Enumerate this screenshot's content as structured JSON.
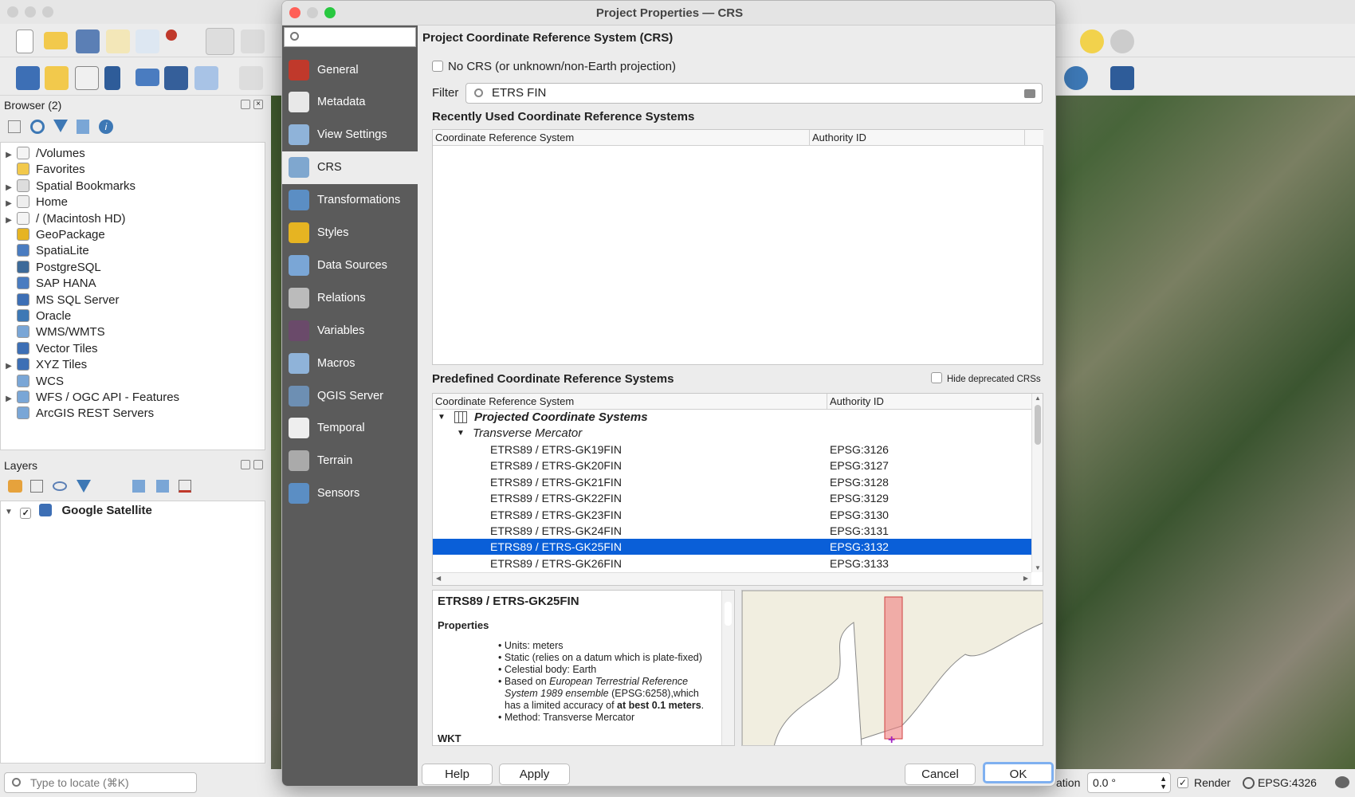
{
  "main_window": {
    "browser_panel": {
      "title": "Browser (2)",
      "items": [
        {
          "label": "/Volumes",
          "expandable": true,
          "icon": "folder-icon"
        },
        {
          "label": "Favorites",
          "expandable": false,
          "icon": "star-icon"
        },
        {
          "label": "Spatial Bookmarks",
          "expandable": true,
          "icon": "bookmark-icon"
        },
        {
          "label": "Home",
          "expandable": true,
          "icon": "home-icon"
        },
        {
          "label": "/ (Macintosh HD)",
          "expandable": true,
          "icon": "folder-icon"
        },
        {
          "label": "GeoPackage",
          "expandable": false,
          "icon": "geopackage-icon"
        },
        {
          "label": "SpatiaLite",
          "expandable": false,
          "icon": "spatialite-icon"
        },
        {
          "label": "PostgreSQL",
          "expandable": false,
          "icon": "postgresql-icon"
        },
        {
          "label": "SAP HANA",
          "expandable": false,
          "icon": "sap-hana-icon"
        },
        {
          "label": "MS SQL Server",
          "expandable": false,
          "icon": "mssql-icon"
        },
        {
          "label": "Oracle",
          "expandable": false,
          "icon": "oracle-icon"
        },
        {
          "label": "WMS/WMTS",
          "expandable": false,
          "icon": "globe-icon"
        },
        {
          "label": "Vector Tiles",
          "expandable": false,
          "icon": "grid-icon"
        },
        {
          "label": "XYZ Tiles",
          "expandable": true,
          "icon": "grid-icon"
        },
        {
          "label": "WCS",
          "expandable": false,
          "icon": "globe-icon"
        },
        {
          "label": "WFS / OGC API - Features",
          "expandable": true,
          "icon": "globe-icon"
        },
        {
          "label": "ArcGIS REST Servers",
          "expandable": false,
          "icon": "globe-icon"
        }
      ]
    },
    "layers_panel": {
      "title": "Layers",
      "layers": [
        {
          "label": "Google Satellite",
          "checked": true
        }
      ]
    },
    "locator": {
      "placeholder": "Type to locate (⌘K)"
    },
    "status_bar": {
      "rotation_label": "ation",
      "rotation_value": "0.0 °",
      "render_label": "Render",
      "render_checked": true,
      "crs": "EPSG:4326"
    }
  },
  "dialog": {
    "title": "Project Properties — CRS",
    "search_placeholder": "",
    "nav": [
      {
        "label": "General",
        "color": "#c0392b"
      },
      {
        "label": "Metadata",
        "color": "#e8e8e8"
      },
      {
        "label": "View Settings",
        "color": "#8fb3d9"
      },
      {
        "label": "CRS",
        "color": "#7fa7cf",
        "active": true
      },
      {
        "label": "Transformations",
        "color": "#5b8ec4"
      },
      {
        "label": "Styles",
        "color": "#e6b422"
      },
      {
        "label": "Data Sources",
        "color": "#7aa6d6"
      },
      {
        "label": "Relations",
        "color": "#bbbbbb"
      },
      {
        "label": "Variables",
        "color": "#6a4a6a"
      },
      {
        "label": "Macros",
        "color": "#8fb3d9"
      },
      {
        "label": "QGIS Server",
        "color": "#6d8fb3"
      },
      {
        "label": "Temporal",
        "color": "#eeeeee"
      },
      {
        "label": "Terrain",
        "color": "#aaaaaa"
      },
      {
        "label": "Sensors",
        "color": "#5b8ec4"
      }
    ],
    "heading": "Project Coordinate Reference System (CRS)",
    "no_crs_label": "No CRS (or unknown/non-Earth projection)",
    "no_crs_checked": false,
    "filter_label": "Filter",
    "filter_value": "ETRS FIN",
    "recent_title": "Recently Used Coordinate Reference Systems",
    "recent_columns": [
      "Coordinate Reference System",
      "Authority ID"
    ],
    "predefined_title": "Predefined Coordinate Reference Systems",
    "hide_deprecated_label": "Hide deprecated CRSs",
    "hide_deprecated_checked": false,
    "predefined_columns": [
      "Coordinate Reference System",
      "Authority ID"
    ],
    "group": "Projected Coordinate Systems",
    "subgroup": "Transverse Mercator",
    "rows": [
      {
        "name": "ETRS89 / ETRS-GK19FIN",
        "id": "EPSG:3126"
      },
      {
        "name": "ETRS89 / ETRS-GK20FIN",
        "id": "EPSG:3127"
      },
      {
        "name": "ETRS89 / ETRS-GK21FIN",
        "id": "EPSG:3128"
      },
      {
        "name": "ETRS89 / ETRS-GK22FIN",
        "id": "EPSG:3129"
      },
      {
        "name": "ETRS89 / ETRS-GK23FIN",
        "id": "EPSG:3130"
      },
      {
        "name": "ETRS89 / ETRS-GK24FIN",
        "id": "EPSG:3131"
      },
      {
        "name": "ETRS89 / ETRS-GK25FIN",
        "id": "EPSG:3132",
        "selected": true
      },
      {
        "name": "ETRS89 / ETRS-GK26FIN",
        "id": "EPSG:3133"
      }
    ],
    "info": {
      "title": "ETRS89 / ETRS-GK25FIN",
      "properties_heading": "Properties",
      "units": "Units: meters",
      "static": "Static (relies on a datum which is plate-fixed)",
      "body": "Celestial body: Earth",
      "based_on_prefix": "Based on ",
      "based_on_name": "European Terrestrial Reference System 1989 ensemble",
      "based_on_mid": " (EPSG:6258),which has a limited accuracy of ",
      "based_on_bold": "at best 0.1 meters",
      "based_on_end": ".",
      "method": "Method: Transverse Mercator",
      "wkt_heading": "WKT"
    },
    "buttons": {
      "help": "Help",
      "apply": "Apply",
      "cancel": "Cancel",
      "ok": "OK"
    },
    "accent": "#0a5fd8"
  }
}
